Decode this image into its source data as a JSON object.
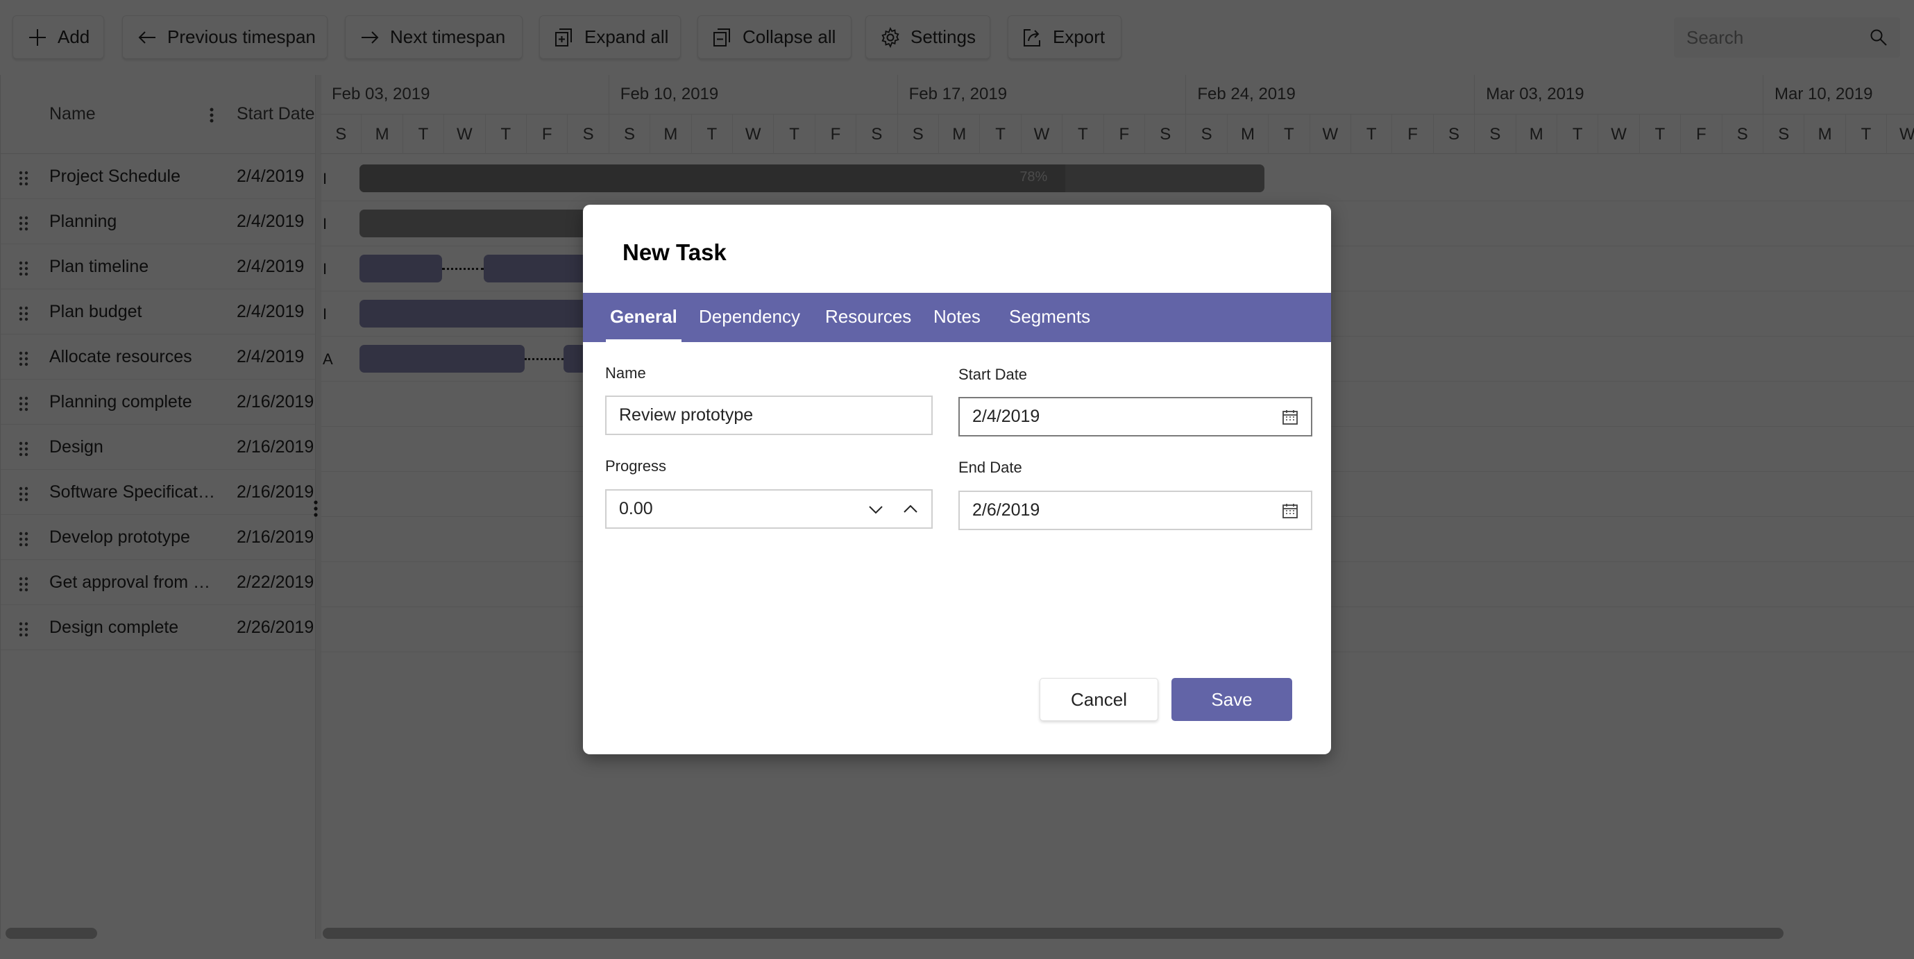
{
  "toolbar": {
    "buttons": [
      {
        "label": "Add",
        "icon": "plus-icon"
      },
      {
        "label": "Previous timespan",
        "icon": "arrow-left-icon"
      },
      {
        "label": "Next timespan",
        "icon": "arrow-right-icon"
      },
      {
        "label": "Expand all",
        "icon": "expand-all-icon"
      },
      {
        "label": "Collapse all",
        "icon": "collapse-all-icon"
      },
      {
        "label": "Settings",
        "icon": "gear-icon"
      },
      {
        "label": "Export",
        "icon": "export-icon"
      }
    ],
    "search": {
      "placeholder": "Search",
      "icon": "search-icon"
    }
  },
  "grid": {
    "columns": {
      "name": "Name",
      "start_date": "Start Date"
    },
    "rows": [
      {
        "name": "Project Schedule",
        "start_date": "2/4/2019"
      },
      {
        "name": "Planning",
        "start_date": "2/4/2019"
      },
      {
        "name": "Plan timeline",
        "start_date": "2/4/2019"
      },
      {
        "name": "Plan budget",
        "start_date": "2/4/2019"
      },
      {
        "name": "Allocate resources",
        "start_date": "2/4/2019"
      },
      {
        "name": "Planning complete",
        "start_date": "2/16/2019"
      },
      {
        "name": "Design",
        "start_date": "2/16/2019"
      },
      {
        "name": "Software Specification",
        "start_date": "2/16/2019"
      },
      {
        "name": "Develop prototype",
        "start_date": "2/16/2019"
      },
      {
        "name": "Get approval from cu...",
        "start_date": "2/22/2019"
      },
      {
        "name": "Design complete",
        "start_date": "2/26/2019"
      }
    ]
  },
  "timeline": {
    "weeks": [
      "Feb 03, 2019",
      "Feb 10, 2019",
      "Feb 17, 2019",
      "Feb 24, 2019",
      "Mar 03, 2019",
      "Mar 10, 2019"
    ],
    "day_letters": [
      "S",
      "M",
      "T",
      "W",
      "T",
      "F",
      "S"
    ],
    "row_labels": [
      "I",
      "I",
      "I",
      "I",
      "A"
    ],
    "summary_progress_label": "78%",
    "summary_progress": 0.78
  },
  "dialog": {
    "title": "New Task",
    "tabs": [
      "General",
      "Dependency",
      "Resources",
      "Notes",
      "Segments"
    ],
    "active_tab": "General",
    "fields": {
      "name_label": "Name",
      "name_value": "Review prototype",
      "progress_label": "Progress",
      "progress_value": "0.00",
      "start_label": "Start Date",
      "start_value": "2/4/2019",
      "end_label": "End Date",
      "end_value": "2/6/2019"
    },
    "cancel_label": "Cancel",
    "save_label": "Save"
  },
  "colors": {
    "accent": "#6264a7",
    "overlay": "rgba(0,0,0,0.64)"
  }
}
